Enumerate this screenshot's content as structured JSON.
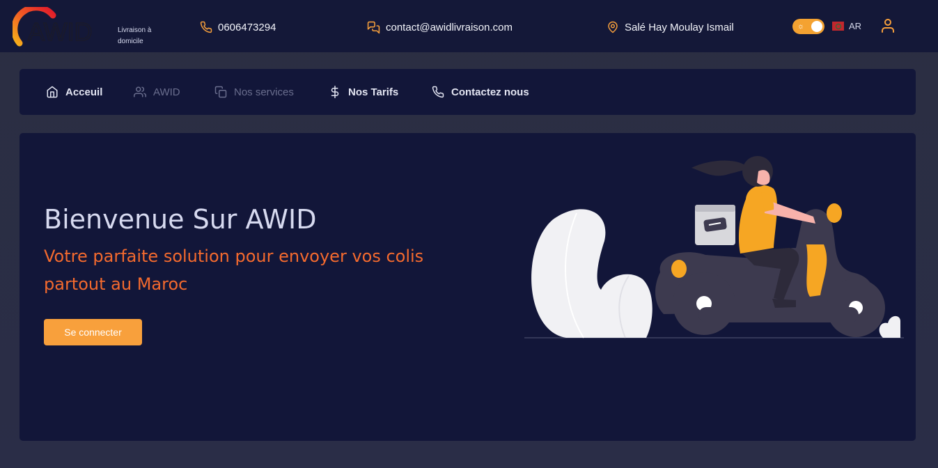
{
  "header": {
    "logo_text": "AWID",
    "logo_subtitle": "Livraison à domicile",
    "phone": "0606473294",
    "email": "contact@awidlivraison.com",
    "address": "Salé Hay Moulay Ismail",
    "language": "AR"
  },
  "nav": {
    "items": [
      {
        "label": "Acceuil",
        "icon": "home-icon"
      },
      {
        "label": "AWID",
        "icon": "users-icon"
      },
      {
        "label": "Nos services",
        "icon": "copy-icon"
      },
      {
        "label": "Nos Tarifs",
        "icon": "dollar-icon"
      },
      {
        "label": "Contactez nous",
        "icon": "phone-icon"
      }
    ]
  },
  "hero": {
    "title": "Bienvenue Sur AWID",
    "subtitle": "Votre parfaite solution pour envoyer vos colis partout au Maroc",
    "cta_label": "Se connecter"
  },
  "colors": {
    "accent": "#f8a03c",
    "subtitle": "#f46a2e",
    "header_bg": "#141838",
    "card_bg": "#121639"
  }
}
